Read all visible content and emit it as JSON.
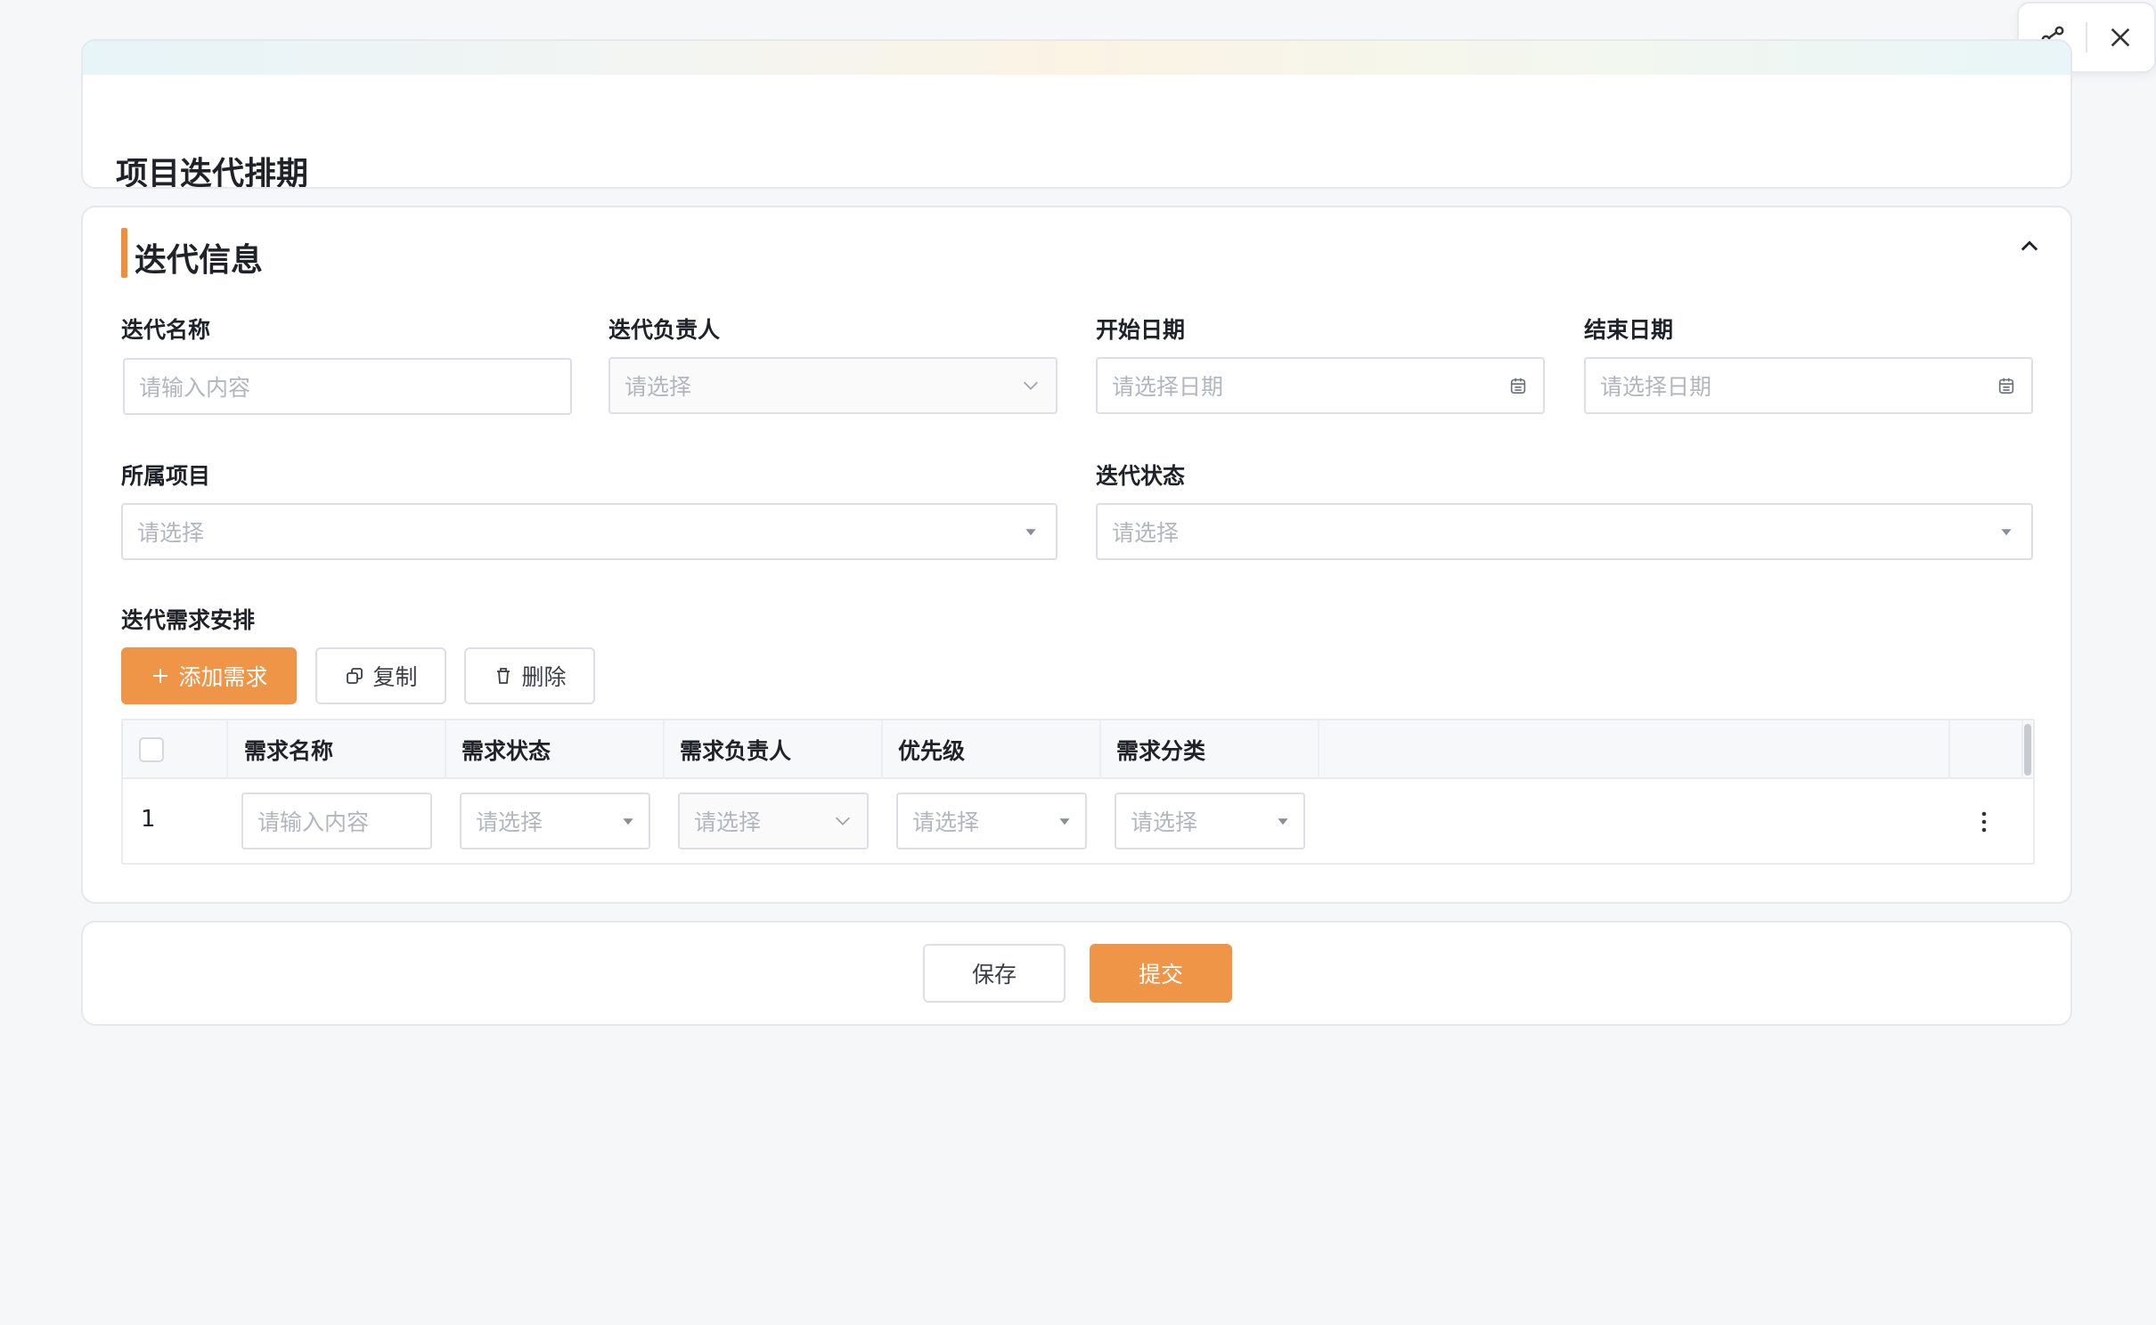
{
  "page": {
    "title": "项目迭代排期"
  },
  "toolbar": {
    "share_icon": "share-icon",
    "close_icon": "close-icon"
  },
  "section": {
    "title": "迭代信息",
    "accent_color": "#ef8f3c"
  },
  "form": {
    "iteration_name": {
      "label": "迭代名称",
      "placeholder": "请输入内容"
    },
    "owner": {
      "label": "迭代负责人",
      "placeholder": "请选择"
    },
    "start_date": {
      "label": "开始日期",
      "placeholder": "请选择日期"
    },
    "end_date": {
      "label": "结束日期",
      "placeholder": "请选择日期"
    },
    "project": {
      "label": "所属项目",
      "placeholder": "请选择"
    },
    "status": {
      "label": "迭代状态",
      "placeholder": "请选择"
    }
  },
  "requirements": {
    "label": "迭代需求安排",
    "add_button": "添加需求",
    "copy_button": "复制",
    "delete_button": "删除",
    "columns": [
      "需求名称",
      "需求状态",
      "需求负责人",
      "优先级",
      "需求分类"
    ],
    "rows": [
      {
        "index": "1",
        "name_placeholder": "请输入内容",
        "status_placeholder": "请选择",
        "owner_placeholder": "请选择",
        "priority_placeholder": "请选择",
        "category_placeholder": "请选择"
      }
    ]
  },
  "footer": {
    "save_button": "保存",
    "submit_button": "提交",
    "primary_color": "#ef9548"
  }
}
